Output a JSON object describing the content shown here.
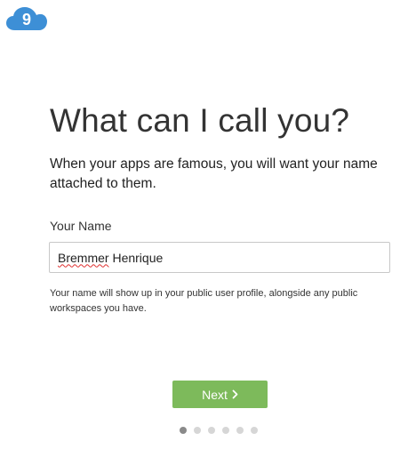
{
  "logo": {
    "glyph": "9",
    "icon": "cloud-icon",
    "color": "#3d8fd6"
  },
  "heading": "What can I call you?",
  "subtitle": "When your apps are famous, you will want your name attached to them.",
  "name_field": {
    "label": "Your Name",
    "first_name": "Bremmer",
    "last_name": "Henrique"
  },
  "help_text": "Your name will show up in your public user profile, alongside any public workspaces you have.",
  "next_button": {
    "label": "Next",
    "icon": "chevron-right-icon",
    "color": "#7dba5b"
  },
  "pagination": {
    "total_steps": 6,
    "current_step": 1
  }
}
